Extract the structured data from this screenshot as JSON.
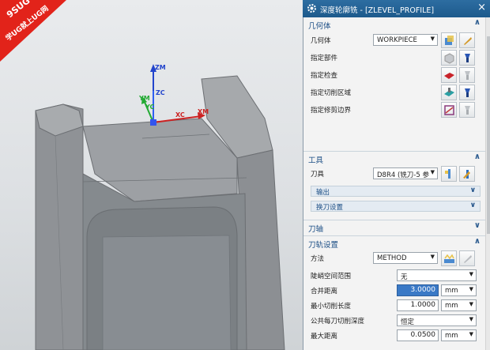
{
  "watermark": {
    "line1": "9SUG",
    "line2": "学UG就上UG网"
  },
  "viewport": {
    "axes": {
      "zm": "ZM",
      "zc": "ZC",
      "ym": "YM",
      "yc": "YC",
      "xc": "XC",
      "xm": "XM"
    }
  },
  "dialog": {
    "title": "深度轮廓铣 - [ZLEVEL_PROFILE]",
    "close_glyph": "×",
    "sections": {
      "geometry": {
        "label": "几何体",
        "chevron": "∧",
        "geometry_label": "几何体",
        "geometry_value": "WORKPIECE",
        "specify_part": "指定部件",
        "specify_check": "指定检查",
        "specify_cut_area": "指定切削区域",
        "specify_trim": "指定修剪边界"
      },
      "tool": {
        "label": "工具",
        "chevron": "∧",
        "tool_label": "刀具",
        "tool_value": "D8R4 (铣刀-5 参",
        "output_label": "输出",
        "output_chevron": "∨",
        "change_tool_label": "换刀设置",
        "change_tool_chevron": "∨"
      },
      "tool_axis": {
        "label": "刀轴",
        "chevron": "∨"
      },
      "path_settings": {
        "label": "刀轨设置",
        "chevron": "∧",
        "method_label": "方法",
        "method_value": "METHOD",
        "steep_label": "陡峭空间范围",
        "steep_value": "无",
        "merge_label": "合并距离",
        "merge_value": "3.0000",
        "merge_unit": "mm",
        "min_cut_label": "最小切削长度",
        "min_cut_value": "1.0000",
        "min_cut_unit": "mm",
        "depth_label": "公共每刀切削深度",
        "depth_value": "恒定",
        "max_dist_label": "最大距离",
        "max_dist_value": "0.0500",
        "max_dist_unit": "mm"
      }
    }
  },
  "colors": {
    "title_bar": "#2d6da1",
    "section_text": "#1d4f86",
    "highlight": "#3a79c6"
  }
}
